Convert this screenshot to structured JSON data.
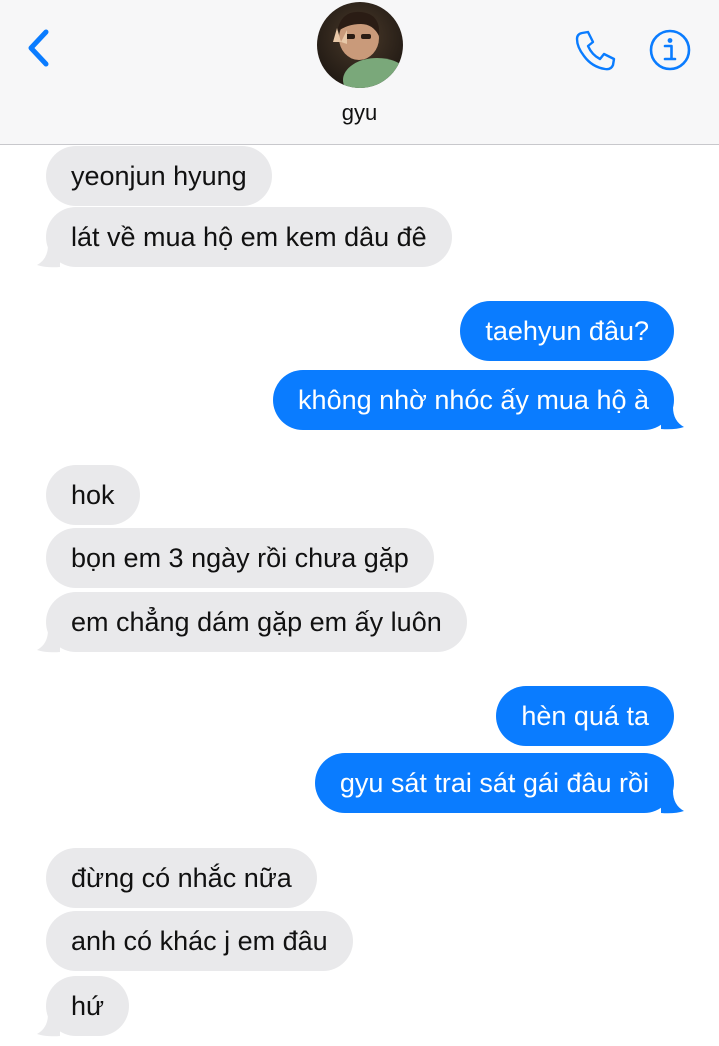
{
  "header": {
    "contact_name": "gyu",
    "back_icon": "chevron-left-icon",
    "call_icon": "phone-icon",
    "info_icon": "info-icon"
  },
  "colors": {
    "sent_bubble": "#0a7cff",
    "received_bubble": "#e9e9eb",
    "accent": "#0a7cff"
  },
  "messages": [
    {
      "from": "them",
      "text": "yeonjun hyung"
    },
    {
      "from": "them",
      "text": "lát về mua hộ em kem dâu đê"
    },
    {
      "from": "me",
      "text": "taehyun đâu?"
    },
    {
      "from": "me",
      "text": "không nhờ nhóc ấy mua hộ à"
    },
    {
      "from": "them",
      "text": "hok"
    },
    {
      "from": "them",
      "text": "bọn em 3 ngày rồi chưa gặp"
    },
    {
      "from": "them",
      "text": "em chẳng dám gặp em ấy luôn"
    },
    {
      "from": "me",
      "text": "hèn quá ta"
    },
    {
      "from": "me",
      "text": "gyu sát trai sát gái đâu rồi"
    },
    {
      "from": "them",
      "text": "đừng có nhắc nữa"
    },
    {
      "from": "them",
      "text": "anh có khác j em đâu"
    },
    {
      "from": "them",
      "text": "hứ"
    }
  ]
}
